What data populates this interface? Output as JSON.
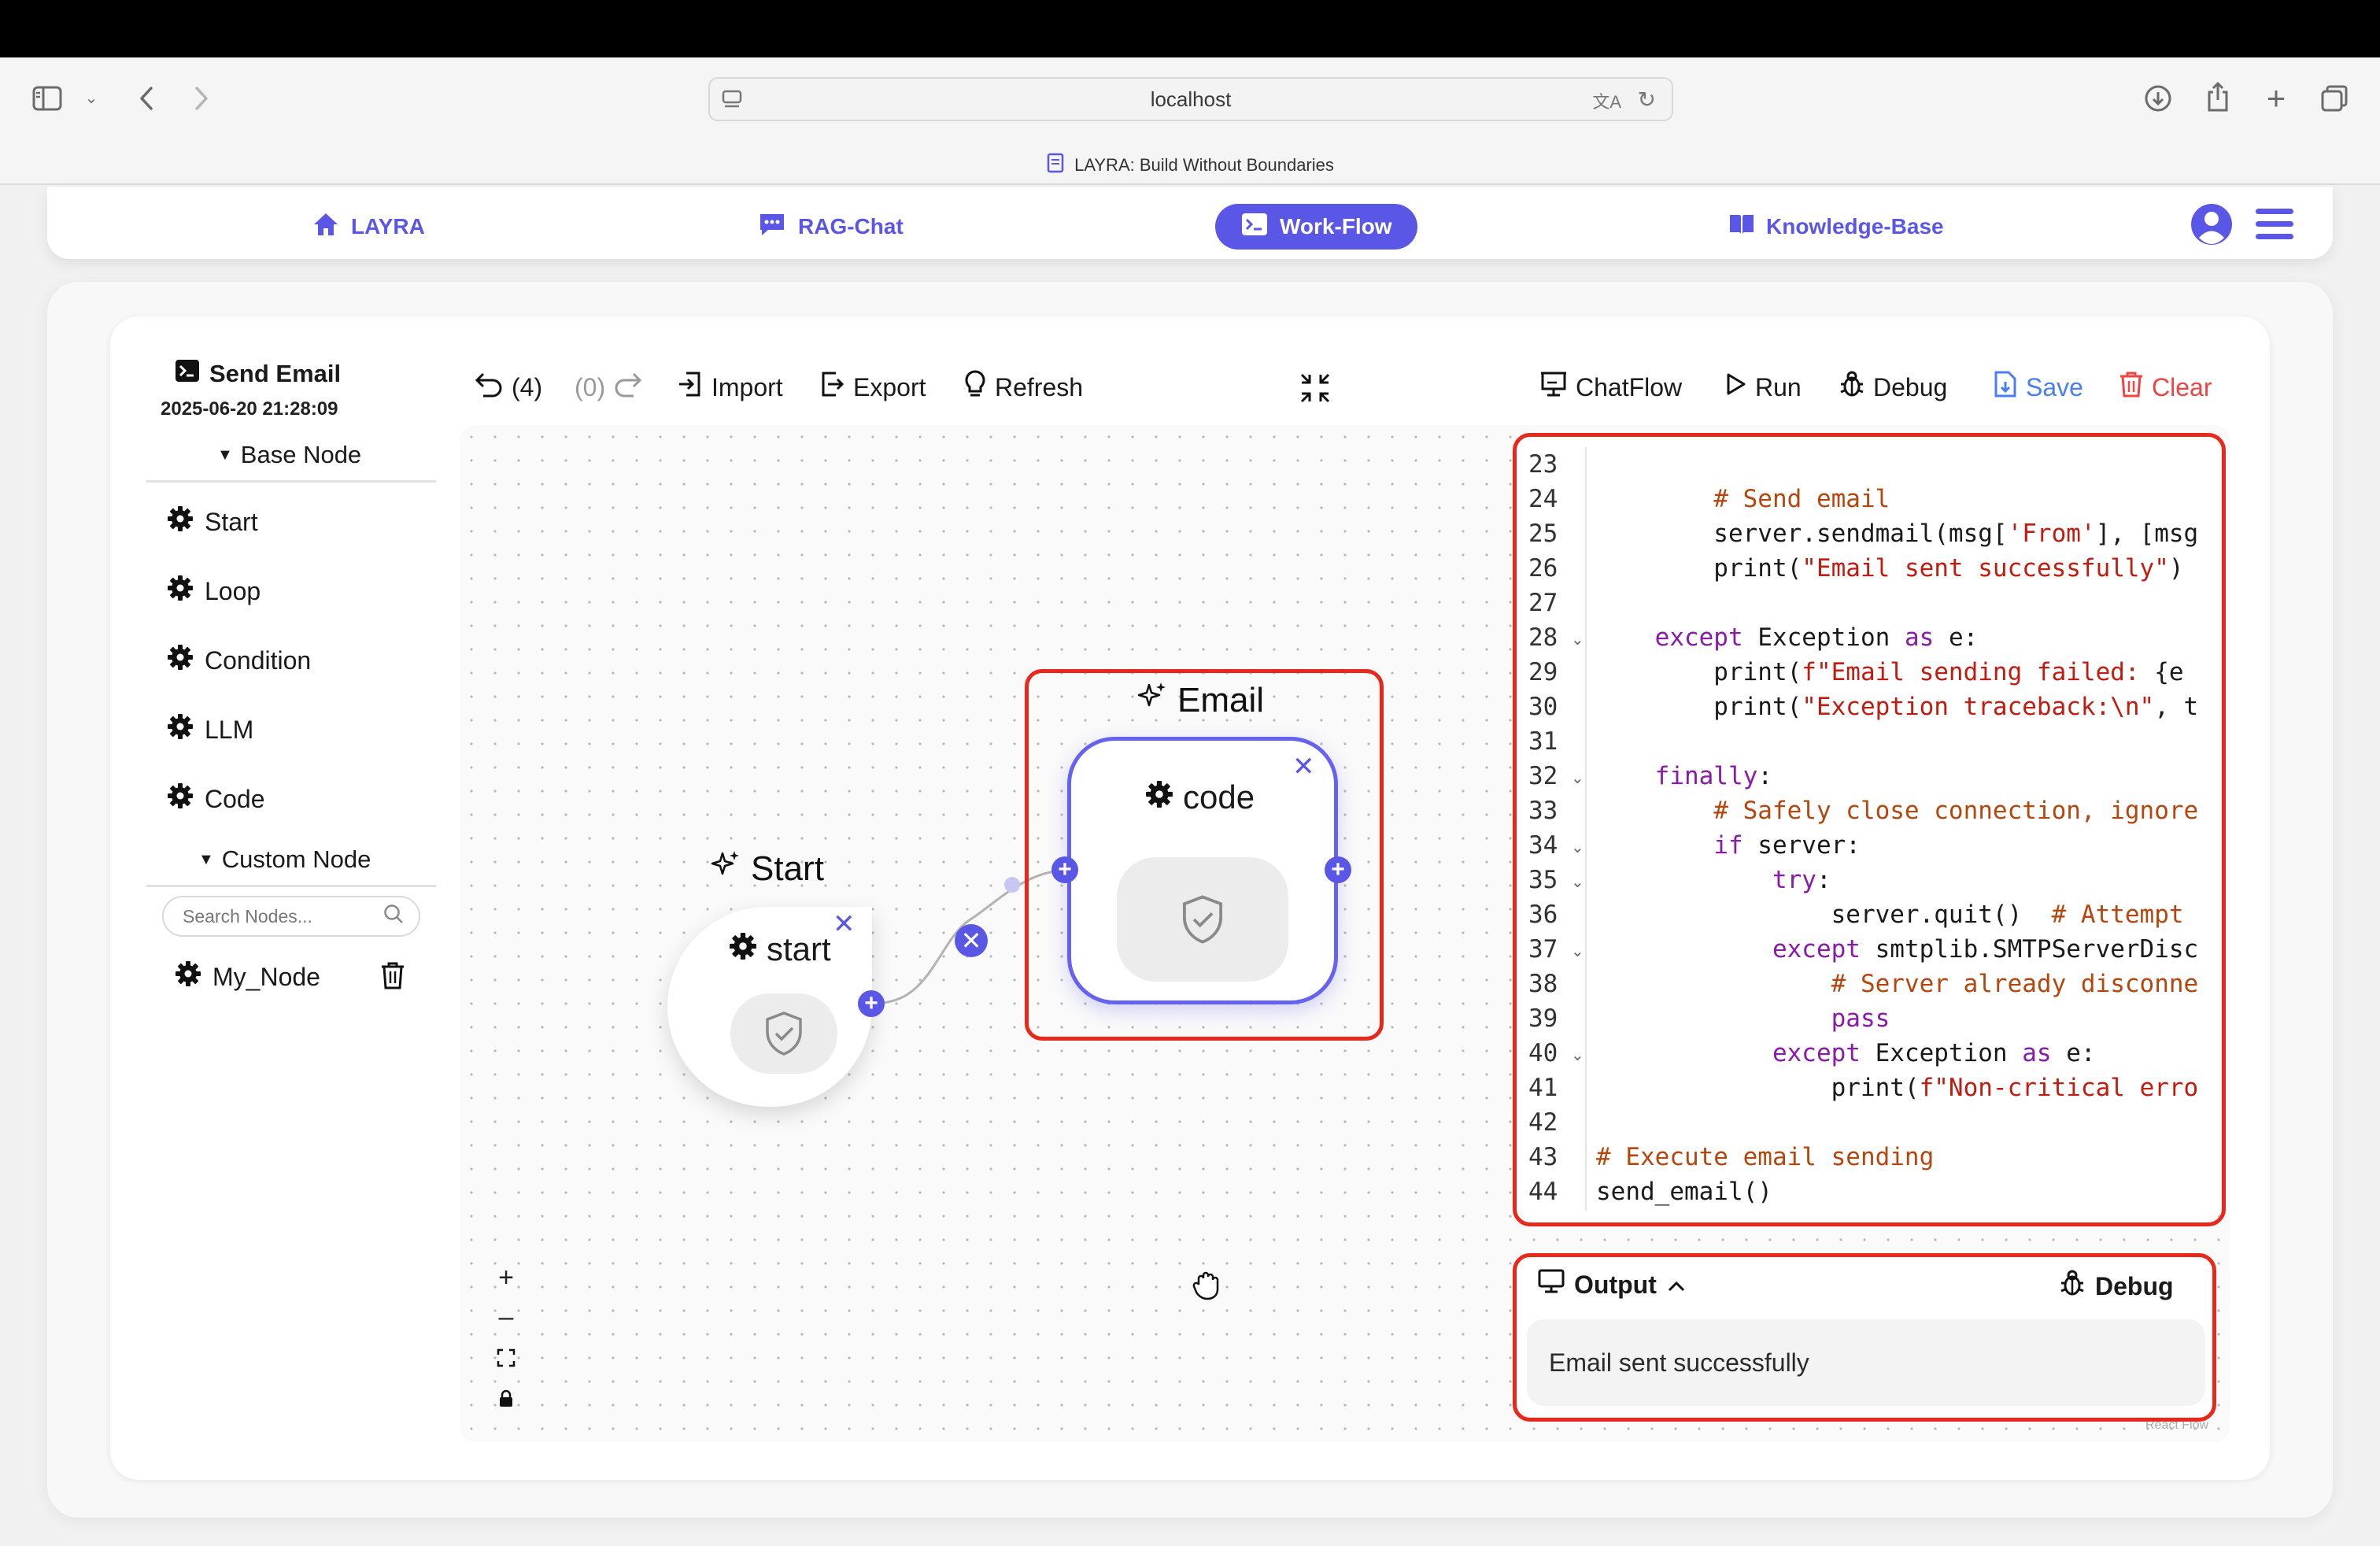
{
  "browser": {
    "url": "localhost",
    "tab_title": "LAYRA: Build Without Boundaries"
  },
  "nav": {
    "items": [
      {
        "label": "LAYRA",
        "icon": "home-icon"
      },
      {
        "label": "RAG-Chat",
        "icon": "chat-icon"
      },
      {
        "label": "Work-Flow",
        "icon": "terminal-icon",
        "active": true
      },
      {
        "label": "Knowledge-Base",
        "icon": "book-icon"
      }
    ],
    "accent": "#5b57e6"
  },
  "sidebar": {
    "workflow_name": "Send Email",
    "timestamp": "2025-06-20 21:28:09",
    "base_section": "Base Node",
    "base_nodes": [
      "Start",
      "Loop",
      "Condition",
      "LLM",
      "Code"
    ],
    "custom_section": "Custom Node",
    "search_placeholder": "Search Nodes...",
    "custom_nodes": [
      "My_Node"
    ]
  },
  "toolbar": {
    "undo": "(4)",
    "redo": "(0)",
    "import": "Import",
    "export": "Export",
    "refresh": "Refresh",
    "chatflow": "ChatFlow",
    "run": "Run",
    "debug": "Debug",
    "save": "Save",
    "clear": "Clear"
  },
  "canvas": {
    "start_label": "Start",
    "start_node": "start",
    "email_label": "Email",
    "code_node": "code",
    "watermark": "React Flow"
  },
  "code_editor": {
    "lines": [
      {
        "n": "23",
        "t": ""
      },
      {
        "n": "24",
        "t": "        # Send email"
      },
      {
        "n": "25",
        "t": "        server.sendmail(msg['From'], [msg"
      },
      {
        "n": "26",
        "t": "        print(\"Email sent successfully\")"
      },
      {
        "n": "27",
        "t": ""
      },
      {
        "n": "28",
        "t": "    except Exception as e:"
      },
      {
        "n": "29",
        "t": "        print(f\"Email sending failed: {e"
      },
      {
        "n": "30",
        "t": "        print(\"Exception traceback:\\n\", t"
      },
      {
        "n": "31",
        "t": ""
      },
      {
        "n": "32",
        "t": "    finally:"
      },
      {
        "n": "33",
        "t": "        # Safely close connection, ignore"
      },
      {
        "n": "34",
        "t": "        if server:"
      },
      {
        "n": "35",
        "t": "            try:"
      },
      {
        "n": "36",
        "t": "                server.quit()  # Attempt"
      },
      {
        "n": "37",
        "t": "            except smtplib.SMTPServerDisc"
      },
      {
        "n": "38",
        "t": "                # Server already disconne"
      },
      {
        "n": "39",
        "t": "                pass"
      },
      {
        "n": "40",
        "t": "            except Exception as e:"
      },
      {
        "n": "41",
        "t": "                print(f\"Non-critical erro"
      },
      {
        "n": "42",
        "t": ""
      },
      {
        "n": "43",
        "t": "# Execute email sending"
      },
      {
        "n": "44",
        "t": "send_email()"
      }
    ]
  },
  "output": {
    "title": "Output",
    "debug": "Debug",
    "message": "Email sent successfully"
  }
}
